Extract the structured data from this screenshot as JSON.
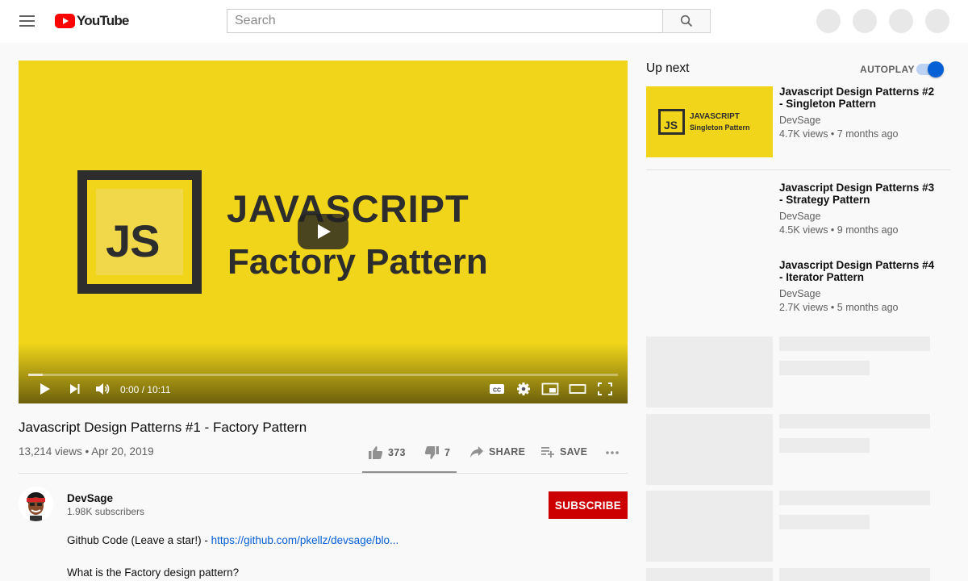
{
  "header": {
    "logo_text": "YouTube",
    "search_placeholder": "Search"
  },
  "player": {
    "thumbnail": {
      "badge": "JS",
      "line1": "JAVASCRIPT",
      "line2": "Factory Pattern"
    },
    "time": "0:00 / 10:11",
    "progress_fraction": 0.0
  },
  "video": {
    "title": "Javascript Design Patterns #1 - Factory Pattern",
    "meta": "13,214 views • Apr 20, 2019",
    "likes": "373",
    "dislikes": "7",
    "share_label": "SHARE",
    "save_label": "SAVE"
  },
  "channel": {
    "name": "DevSage",
    "subscribers": "1.98K subscribers",
    "subscribe_label": "SUBSCRIBE"
  },
  "description": {
    "line1_text": "Github Code (Leave a star!) - ",
    "line1_link": "https://github.com/pkellz/devsage/blo...",
    "line2": "What is the Factory design pattern?"
  },
  "sidebar": {
    "up_next": "Up next",
    "autoplay": "AUTOPLAY",
    "autoplay_on": true,
    "recommendations": [
      {
        "title": "Javascript Design Patterns #2 - Singleton Pattern",
        "channel": "DevSage",
        "meta": "4.7K views • 7 months ago",
        "thumb_badge": "JS",
        "thumb_line1": "JAVASCRIPT",
        "thumb_line2": "Singleton Pattern"
      },
      {
        "title": "Javascript Design Patterns #3 - Strategy Pattern",
        "channel": "DevSage",
        "meta": "4.5K views • 9 months ago"
      },
      {
        "title": "Javascript Design Patterns #4 - Iterator Pattern",
        "channel": "DevSage",
        "meta": "2.7K views • 5 months ago"
      }
    ]
  },
  "colors": {
    "brand_red": "#ff0000",
    "subscribe_red": "#cc0000",
    "thumbnail_yellow": "#f0d51a",
    "link_blue": "#065fd4"
  }
}
